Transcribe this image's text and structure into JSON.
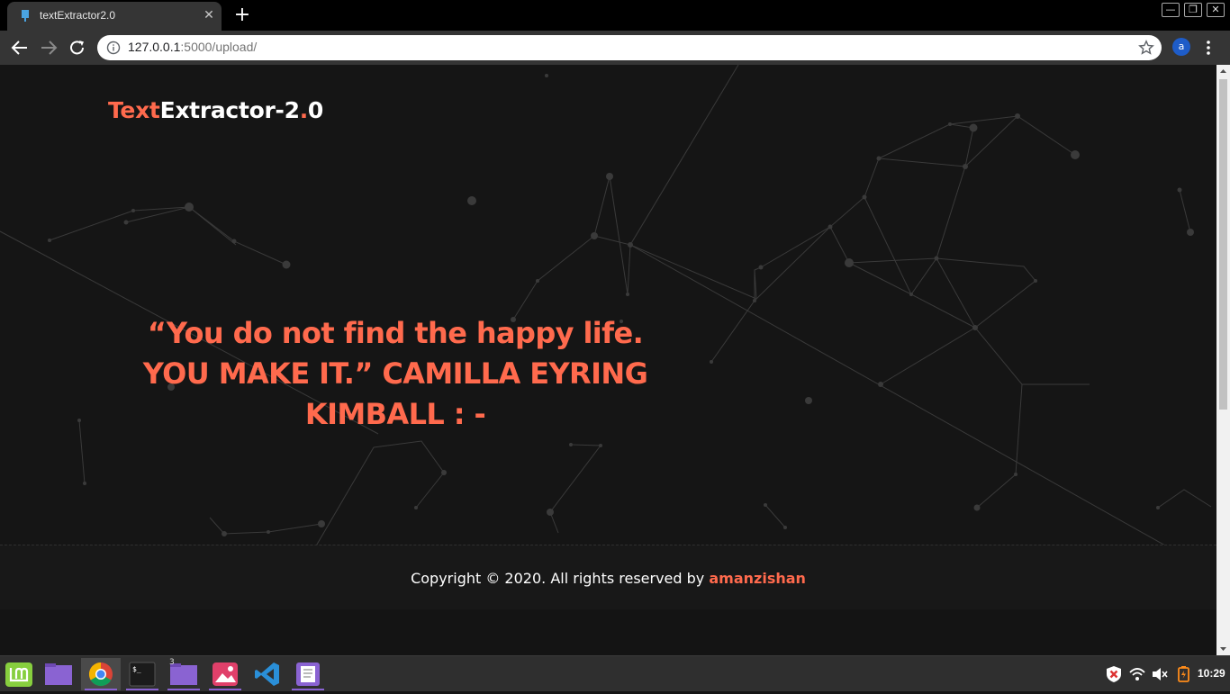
{
  "browser": {
    "tab_title": "textExtractor2.0",
    "tab_close": "✕",
    "new_tab": "+",
    "url_host": "127.0.0.1",
    "url_path": ":5000/upload/",
    "profile_initial": "a",
    "window_buttons": {
      "minimize": "—",
      "restore": "❐",
      "close": "✕"
    }
  },
  "page": {
    "brand": {
      "part1": "Text",
      "part2": "Extractor-2",
      "dot": ".",
      "part3": "0"
    },
    "quote": "“You do not find the happy life. YOU MAKE IT.” CAMILLA EYRING KIMBALL : -",
    "footer": {
      "text": "Copyright © 2020. All rights reserved by ",
      "author": "amanzishan"
    }
  },
  "taskbar": {
    "files_badge": "3",
    "clock": "10:29"
  },
  "colors": {
    "accent": "#ff6a4d",
    "background": "#141414",
    "taskbar_highlight": "#8a63d2"
  }
}
